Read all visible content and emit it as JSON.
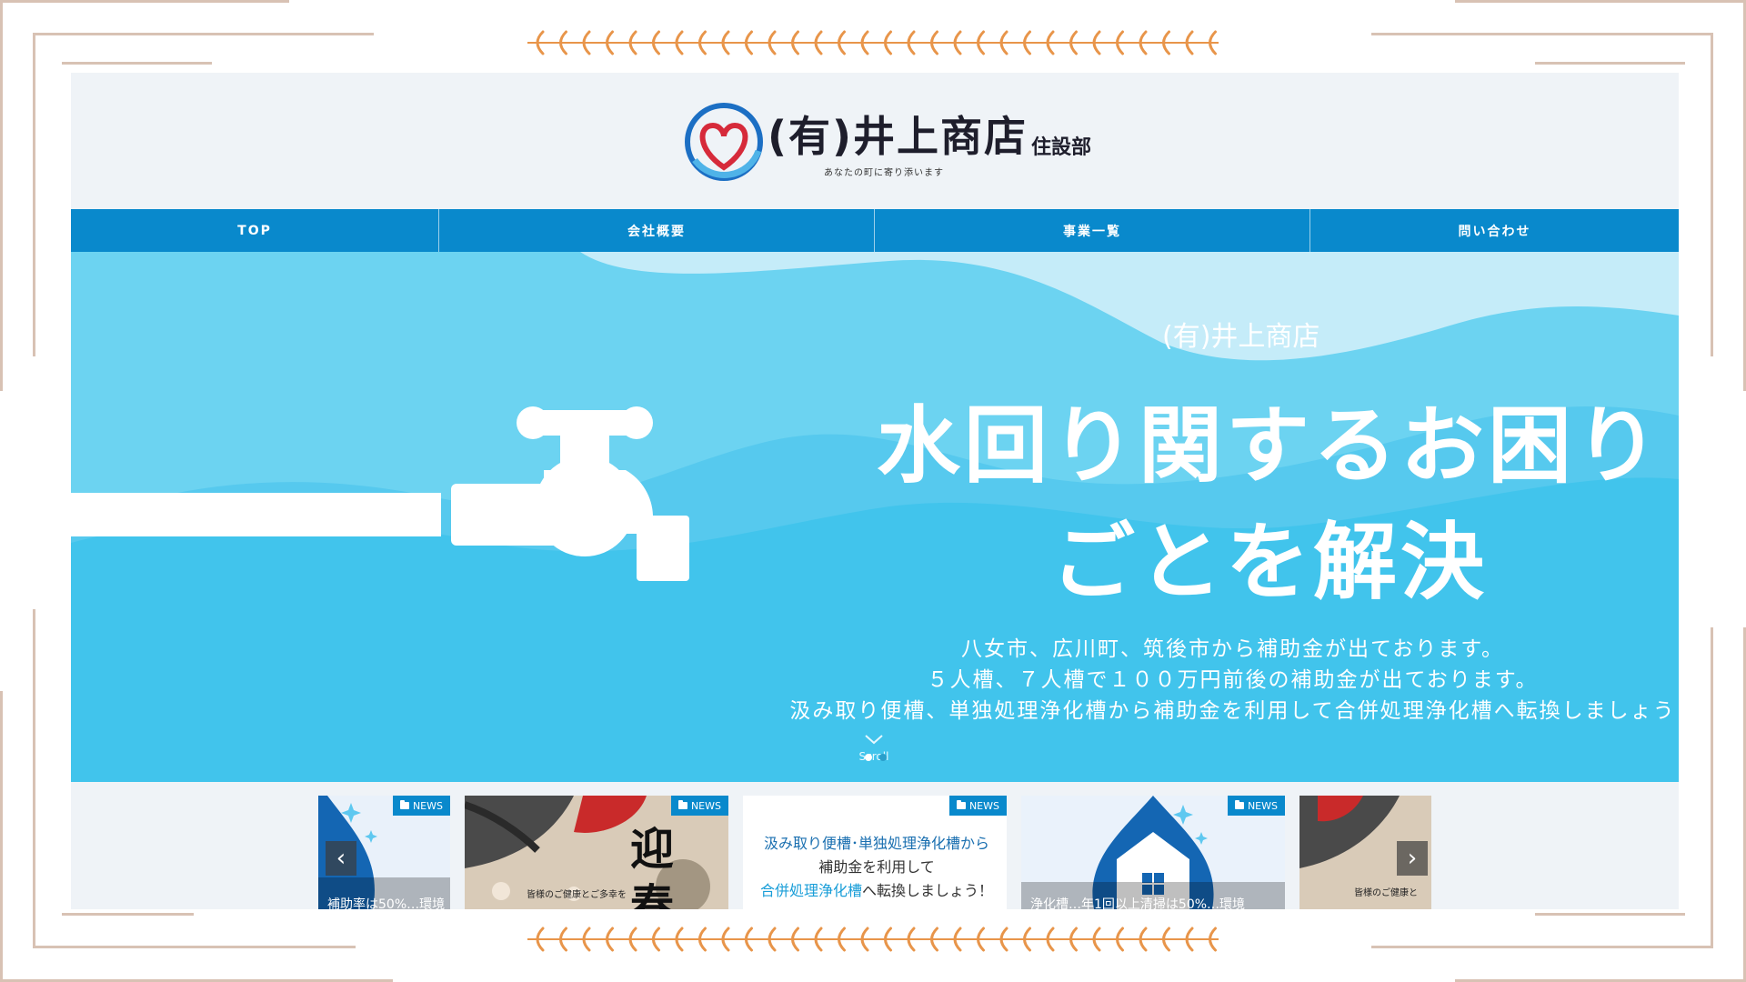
{
  "site": {
    "logo_text": "(有)井上商店",
    "logo_sub": "住設部",
    "logo_tagline": "あなたの町に寄り添います"
  },
  "nav": {
    "items": [
      {
        "label": "TOP"
      },
      {
        "label": "会社概要"
      },
      {
        "label": "事業一覧"
      },
      {
        "label": "問い合わせ"
      }
    ]
  },
  "hero": {
    "company": "(有)井上商店",
    "title_line1": "水回り関するお困り",
    "title_line2": "ごとを解決",
    "body": [
      "八女市、広川町、筑後市から補助金が出ております。",
      "５人槽、７人槽で１００万円前後の補助金が出ております。",
      "汲み取り便槽、単独処理浄化槽から補助金を利用して合併処理浄化槽へ転換しましょう"
    ],
    "scroll_label": "Scroll",
    "slide_count": 2,
    "active_slide": 1
  },
  "cards": {
    "badge": "NEWS",
    "items": [
      {
        "caption": "補助率は50%…環境",
        "image": "house-drop"
      },
      {
        "caption": "",
        "image": "new-year-koi",
        "image_text": "迎春",
        "image_sub": "皆様のご健康とご多幸を"
      },
      {
        "caption": "",
        "image": "text-banner",
        "line1": "汲み取り便槽･単独処理浄化槽から",
        "line2": "補助金を利用して",
        "line3_highlight": "合併処理浄化槽",
        "line3_rest": "へ転換しましょう！"
      },
      {
        "caption": "浄化槽…年1回以上清掃は50%…環境",
        "image": "house-drop"
      },
      {
        "caption": "",
        "image": "new-year-koi",
        "image_sub": "皆様のご健康と"
      }
    ],
    "prev_label": "‹",
    "next_label": "›"
  },
  "colors": {
    "nav": "#0989cc",
    "hero": "#41c4ec",
    "frame": "#d8c2b4",
    "leaf": "#e8954a"
  }
}
